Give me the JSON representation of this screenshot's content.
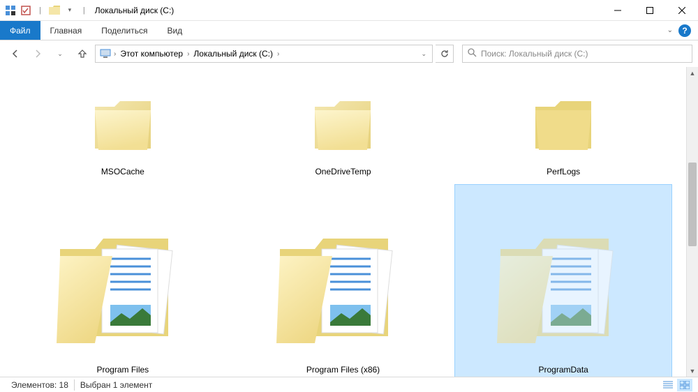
{
  "window": {
    "title": "Локальный диск (C:)"
  },
  "ribbon": {
    "file": "Файл",
    "tabs": [
      "Главная",
      "Поделиться",
      "Вид"
    ]
  },
  "breadcrumb": {
    "segments": [
      "Этот компьютер",
      "Локальный диск (C:)"
    ]
  },
  "search": {
    "placeholder": "Поиск: Локальный диск (C:)"
  },
  "folders": [
    {
      "name": "MSOCache",
      "type": "empty",
      "selected": false
    },
    {
      "name": "OneDriveTemp",
      "type": "empty",
      "selected": false
    },
    {
      "name": "PerfLogs",
      "type": "empty",
      "selected": false
    },
    {
      "name": "Program Files",
      "type": "docs",
      "selected": false
    },
    {
      "name": "Program Files (x86)",
      "type": "docs",
      "selected": false
    },
    {
      "name": "ProgramData",
      "type": "docs",
      "selected": true
    }
  ],
  "status": {
    "count_label": "Элементов:",
    "count": "18",
    "selection": "Выбран 1 элемент"
  }
}
